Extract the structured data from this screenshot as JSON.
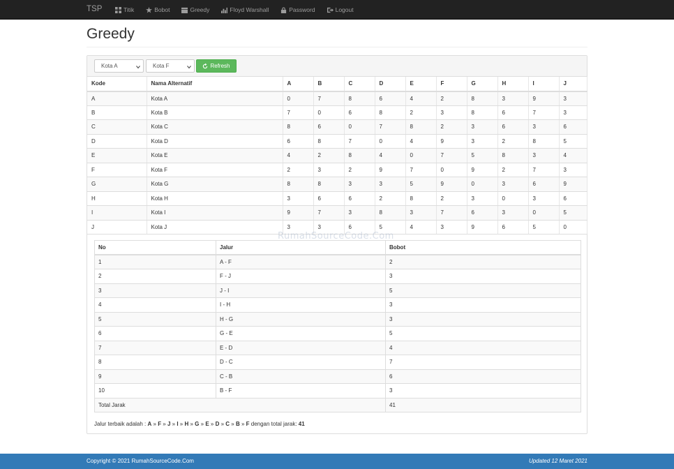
{
  "navbar": {
    "brand": "TSP",
    "items": [
      {
        "label": "Titik",
        "icon": "th-large-icon"
      },
      {
        "label": "Bobot",
        "icon": "star-icon"
      },
      {
        "label": "Greedy",
        "icon": "calendar-icon"
      },
      {
        "label": "Floyd Warshall",
        "icon": "stats-icon"
      },
      {
        "label": "Password",
        "icon": "lock-icon"
      },
      {
        "label": "Logout",
        "icon": "logout-icon"
      }
    ]
  },
  "page": {
    "title": "Greedy"
  },
  "filters": {
    "from_city": "Kota A",
    "to_city": "Kota F",
    "refresh_label": "Refresh"
  },
  "matrix": {
    "headers": [
      "Kode",
      "Nama Alternatif",
      "A",
      "B",
      "C",
      "D",
      "E",
      "F",
      "G",
      "H",
      "I",
      "J"
    ],
    "rows": [
      [
        "A",
        "Kota A",
        "0",
        "7",
        "8",
        "6",
        "4",
        "2",
        "8",
        "3",
        "9",
        "3"
      ],
      [
        "B",
        "Kota B",
        "7",
        "0",
        "6",
        "8",
        "2",
        "3",
        "8",
        "6",
        "7",
        "3"
      ],
      [
        "C",
        "Kota C",
        "8",
        "6",
        "0",
        "7",
        "8",
        "2",
        "3",
        "6",
        "3",
        "6"
      ],
      [
        "D",
        "Kota D",
        "6",
        "8",
        "7",
        "0",
        "4",
        "9",
        "3",
        "2",
        "8",
        "5"
      ],
      [
        "E",
        "Kota E",
        "4",
        "2",
        "8",
        "4",
        "0",
        "7",
        "5",
        "8",
        "3",
        "4"
      ],
      [
        "F",
        "Kota F",
        "2",
        "3",
        "2",
        "9",
        "7",
        "0",
        "9",
        "2",
        "7",
        "3"
      ],
      [
        "G",
        "Kota G",
        "8",
        "8",
        "3",
        "3",
        "5",
        "9",
        "0",
        "3",
        "6",
        "9"
      ],
      [
        "H",
        "Kota H",
        "3",
        "6",
        "6",
        "2",
        "8",
        "2",
        "3",
        "0",
        "3",
        "6"
      ],
      [
        "I",
        "Kota I",
        "9",
        "7",
        "3",
        "8",
        "3",
        "7",
        "6",
        "3",
        "0",
        "5"
      ],
      [
        "J",
        "Kota J",
        "3",
        "3",
        "6",
        "5",
        "4",
        "3",
        "9",
        "6",
        "5",
        "0"
      ]
    ]
  },
  "routes": {
    "headers": [
      "No",
      "Jalur",
      "Bobot"
    ],
    "rows": [
      [
        "1",
        "A - F",
        "2"
      ],
      [
        "2",
        "F - J",
        "3"
      ],
      [
        "3",
        "J - I",
        "5"
      ],
      [
        "4",
        "I - H",
        "3"
      ],
      [
        "5",
        "H - G",
        "3"
      ],
      [
        "6",
        "G - E",
        "5"
      ],
      [
        "7",
        "E - D",
        "4"
      ],
      [
        "8",
        "D - C",
        "7"
      ],
      [
        "9",
        "C - B",
        "6"
      ],
      [
        "10",
        "B - F",
        "3"
      ]
    ],
    "total_label": "Total Jarak",
    "total_value": "41"
  },
  "best_path": {
    "prefix": "Jalur terbaik adalah : ",
    "nodes": [
      "A",
      "F",
      "J",
      "I",
      "H",
      "G",
      "E",
      "D",
      "C",
      "B",
      "F"
    ],
    "separator": " » ",
    "middle": " dengan total jarak: ",
    "total": "41"
  },
  "watermark": "RumahSourceCode.Com",
  "footer": {
    "copyright": "Copyright © 2021 RumahSourceCode.Com",
    "updated": "Updated 12 Maret 2021"
  }
}
